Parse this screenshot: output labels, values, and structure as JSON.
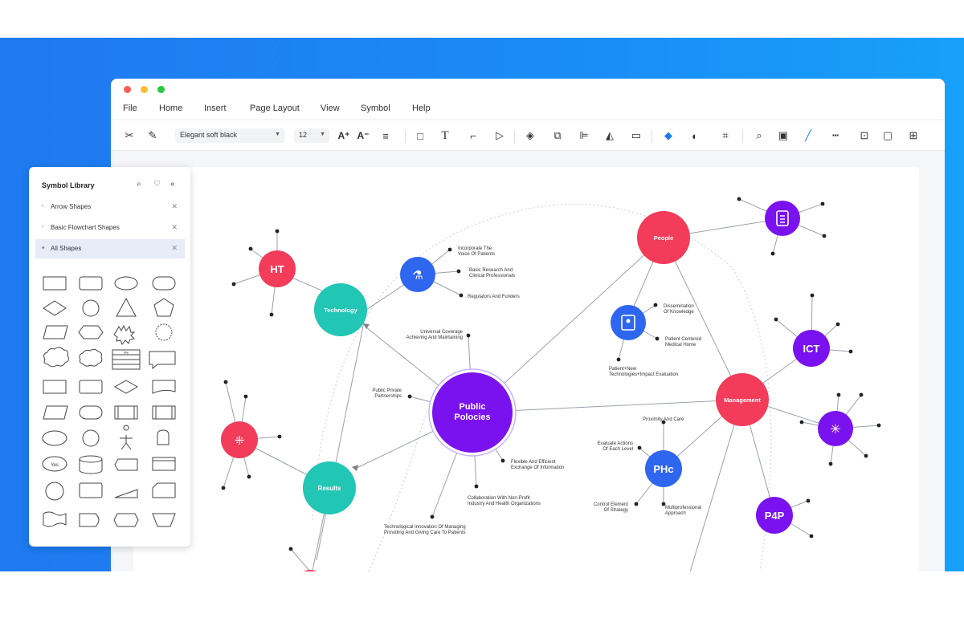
{
  "menu": [
    "File",
    "Home",
    "Insert",
    "Page Layout",
    "View",
    "Symbol",
    "Help"
  ],
  "toolbar": {
    "font_name": "Elegant soft black",
    "font_size": "12"
  },
  "symbol_library": {
    "title": "Symbol Library",
    "sections": [
      {
        "label": "Arrow Shapes",
        "expanded": false
      },
      {
        "label": "Basic Flowchart Shapes",
        "expanded": false
      },
      {
        "label": "All Shapes",
        "expanded": true
      }
    ],
    "shape_labels": {
      "card": "Yes",
      "table": "title"
    }
  },
  "colors": {
    "accent_blue": "#1f79ef",
    "node_red": "#f23c5a",
    "node_teal": "#21c6b5",
    "node_purple": "#7a12f0",
    "node_blue": "#2f66ef"
  },
  "diagram": {
    "center": "Public Polocies",
    "nodes": {
      "technology": "Technology",
      "results": "Results",
      "people": "People",
      "management": "Management",
      "ht": "HT",
      "ict": "ICT",
      "phc": "PHc",
      "p4p": "P4P"
    },
    "labels": {
      "incorporate": [
        "Incorporate The",
        "Voice Of Patients"
      ],
      "basic_research": [
        "Basic Research And",
        "Clinical Professionals"
      ],
      "regulators": [
        "Regulators And Funders"
      ],
      "universal": [
        "Universal Coverage",
        "Achieving And Maintaining"
      ],
      "dissemination": [
        "Dissemination",
        "Of Knowledge"
      ],
      "patient_centered": [
        "Patient Centered",
        "Medical Home"
      ],
      "patient_new": [
        "Patient+New",
        "Technologies+Impact Evaluation"
      ],
      "public_private": [
        "Public Private",
        "Partnerships"
      ],
      "proximity": [
        "Proximity And Care"
      ],
      "evaluate": [
        "Evaluate Actions",
        "Of Each Level"
      ],
      "flexible": [
        "Flexible And Efficient",
        "Exchange Of Information"
      ],
      "collaboration": [
        "Collaboration With Non-Profit",
        "Industry And Health Organizations"
      ],
      "control": [
        "Control Element",
        "Of Strategy"
      ],
      "multiprofessional": [
        "Multiprofessional",
        "Approach"
      ],
      "tech_innovation": [
        "Technological Innovation Of Managing",
        "Providing And Giving Care To Patients"
      ]
    }
  }
}
